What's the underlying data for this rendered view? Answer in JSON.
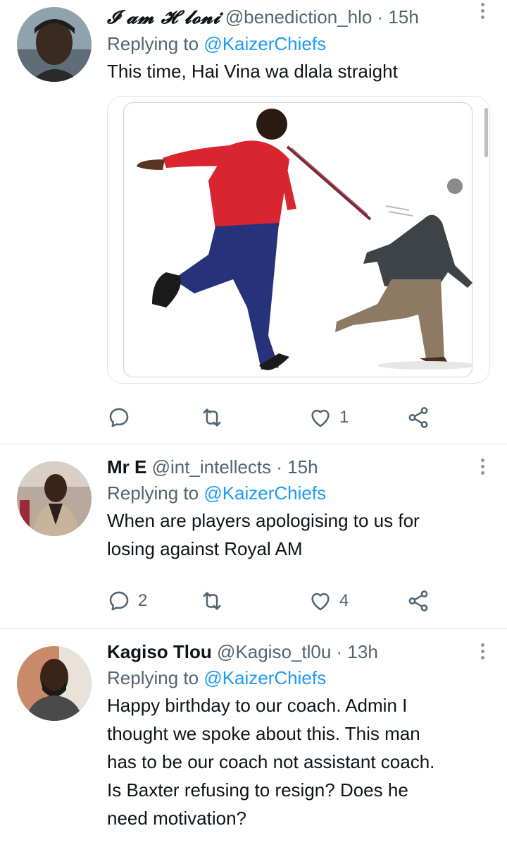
{
  "tweets": [
    {
      "display_name": "𝓘 𝓪𝓶 𝓗 𝓵𝓸𝓷𝓲",
      "handle": "@benediction_hlo",
      "time": "· 15h",
      "replying_prefix": "Replying to",
      "replying_to": "@KaizerChiefs",
      "text": "This time, Hai Vina wa dlala straight",
      "has_media": true,
      "counts": {
        "reply": "",
        "retweet": "",
        "like": "1"
      }
    },
    {
      "display_name": "Mr E",
      "handle": "@int_intellects",
      "time": "· 15h",
      "replying_prefix": "Replying to",
      "replying_to": "@KaizerChiefs",
      "text_lines": [
        "When are players apologising to us for",
        "losing against Royal AM"
      ],
      "counts": {
        "reply": "2",
        "retweet": "",
        "like": "4"
      }
    },
    {
      "display_name": "Kagiso Tlou",
      "handle": "@Kagiso_tl0u",
      "time": "· 13h",
      "replying_prefix": "Replying to",
      "replying_to": "@KaizerChiefs",
      "text_lines": [
        "Happy birthday to our coach. Admin I",
        "thought we spoke about this. This man",
        "has to be our coach not assistant coach.",
        "Is Baxter refusing to resign? Does he",
        "need motivation?"
      ]
    }
  ],
  "colors": {
    "accent": "#1d9bf0",
    "muted": "#536471",
    "text": "#0f1419",
    "divider": "#e6e6e6"
  },
  "icons": [
    "reply-icon",
    "retweet-icon",
    "like-icon",
    "share-icon",
    "more-icon"
  ]
}
